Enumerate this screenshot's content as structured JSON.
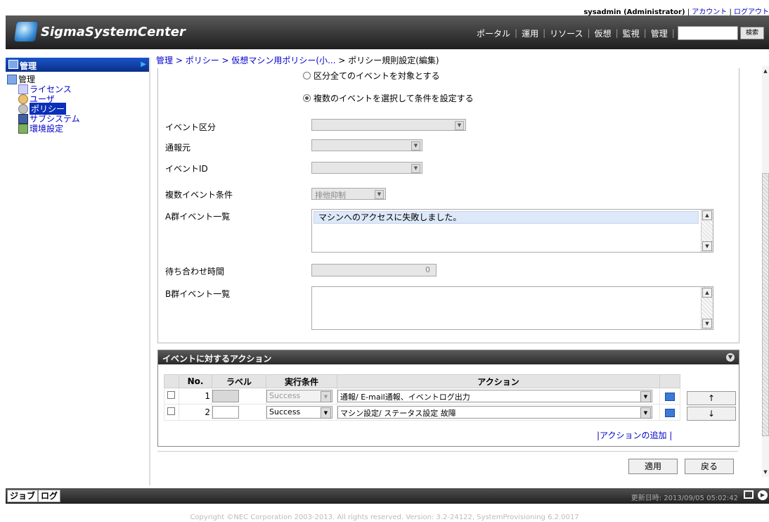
{
  "userbar": {
    "user": "sysadmin (Administrator)",
    "sep1": " | ",
    "account": "アカウント",
    "sep2": " | ",
    "logout": "ログアウト"
  },
  "header": {
    "app_title": "SigmaSystemCenter",
    "nav": [
      "ポータル",
      "運用",
      "リソース",
      "仮想",
      "監視",
      "管理"
    ],
    "search_button": "検索"
  },
  "sidebar": {
    "title": "管理",
    "root": "管理",
    "items": [
      "ライセンス",
      "ユーザ",
      "ポリシー",
      "サブシステム",
      "環境設定"
    ]
  },
  "breadcrumb": {
    "items": [
      "管理",
      "ポリシー",
      "仮想マシン用ポリシー(小..."
    ],
    "sep": " > ",
    "current": "ポリシー規則設定(編集)"
  },
  "form": {
    "radio_all": "区分全てのイベントを対象とする",
    "radio_multi": "複数のイベントを選択して条件を設定する",
    "event_category_label": "イベント区分",
    "event_category_value": "",
    "source_label": "通報元",
    "source_value": "",
    "event_id_label": "イベントID",
    "event_id_value": "",
    "multi_cond_label": "複数イベント条件",
    "multi_cond_value": "排他抑制",
    "group_a_label": "A群イベント一覧",
    "group_a_items": [
      "マシンへのアクセスに失敗しました。"
    ],
    "wait_label": "待ち合わせ時間",
    "wait_value": "0",
    "group_b_label": "B群イベント一覧"
  },
  "actions": {
    "title": "イベントに対するアクション",
    "columns": [
      "No.",
      "ラベル",
      "実行条件",
      "アクション"
    ],
    "rows": [
      {
        "no": "1",
        "label": "",
        "condition": "Success",
        "action": "通報/ E-mail通報、イベントログ出力",
        "disabled": true
      },
      {
        "no": "2",
        "label": "",
        "condition": "Success",
        "action": "マシン設定/ ステータス設定 故障",
        "disabled": false
      }
    ],
    "up_label": "↑",
    "down_label": "↓",
    "add_link": "|アクションの追加 |"
  },
  "buttons": {
    "apply": "適用",
    "back": "戻る"
  },
  "statusbar": {
    "tabs": [
      "ジョブ",
      "ログ"
    ],
    "updated": "更新日時: 2013/09/05 05:02:42"
  },
  "copyright": "Copyright ©NEC Corporation 2003-2013. All rights reserved. Version: 3.2-24122, SystemProvisioning 6.2.0017",
  "colors": {
    "header": "#2a2a2a",
    "link": "#0000cc",
    "selected": "#0a2fb8"
  }
}
